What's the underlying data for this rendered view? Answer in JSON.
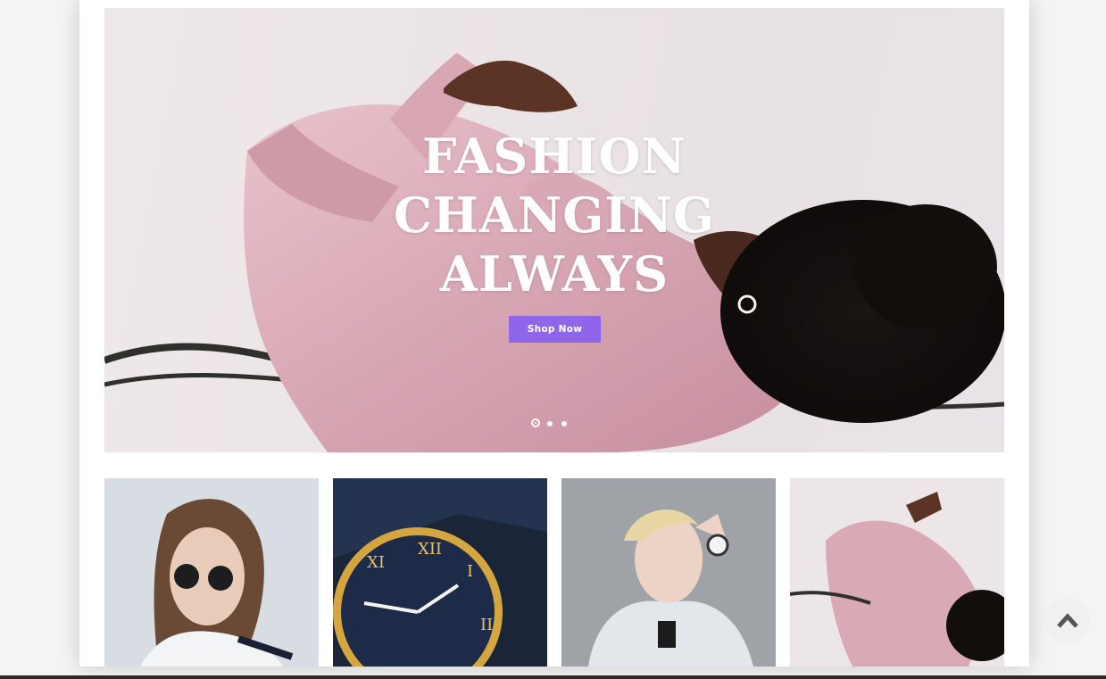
{
  "hero": {
    "title_lines": [
      "FASHION",
      "CHANGING",
      "ALWAYS"
    ],
    "cta_label": "Shop Now",
    "slides": {
      "count": 3,
      "active": 1
    }
  },
  "categories": [
    {
      "image": "woman-with-round-sunglasses"
    },
    {
      "image": "gold-wristwatch"
    },
    {
      "image": "woman-in-adidas-hoodie-with-smartwatch"
    },
    {
      "image": "woman-in-pink-satin-shirt"
    }
  ],
  "colors": {
    "accent": "#8f66ea",
    "hero_background": "#ece5e7",
    "shirt_pink": "#dcaeb9"
  },
  "icons": {
    "scroll_top": "chevron-up-icon"
  }
}
